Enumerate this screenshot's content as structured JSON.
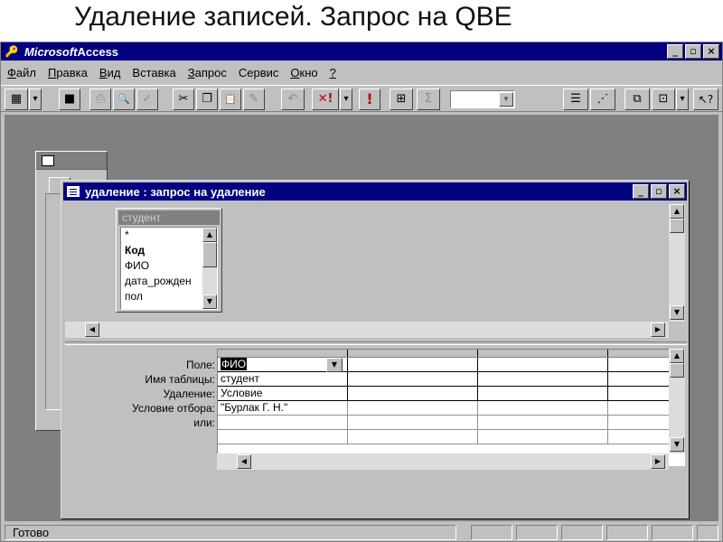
{
  "slide": {
    "title": "Удаление записей. Запрос на QBE"
  },
  "app": {
    "title_brand": "Microsoft",
    "title_rest": " Access",
    "window_buttons": [
      "_",
      "▫",
      "×"
    ]
  },
  "menu": {
    "items": [
      {
        "first": "Ф",
        "rest": "айл"
      },
      {
        "first": "П",
        "rest": "равка"
      },
      {
        "first": "В",
        "rest": "ид"
      },
      {
        "first": "",
        "rest": "Вставка"
      },
      {
        "first": "З",
        "rest": "апрос"
      },
      {
        "first": "",
        "rest": "Сервис"
      },
      {
        "first": "О",
        "rest": "кно"
      },
      {
        "first": "?",
        "rest": ""
      }
    ]
  },
  "toolbar": {
    "buttons": [
      {
        "name": "view-icon",
        "glyph": "▦"
      },
      {
        "name": "view-dropdown-icon",
        "glyph": "▾"
      },
      {
        "name": "save-icon",
        "glyph": "■"
      },
      {
        "name": "print-icon",
        "glyph": "⎙"
      },
      {
        "name": "print-preview-icon",
        "glyph": "🔍"
      },
      {
        "name": "spelling-icon",
        "glyph": "✓"
      },
      {
        "name": "cut-icon",
        "glyph": "✂"
      },
      {
        "name": "copy-icon",
        "glyph": "❐"
      },
      {
        "name": "paste-icon",
        "glyph": "📋"
      },
      {
        "name": "format-painter-icon",
        "glyph": "✎"
      },
      {
        "name": "undo-icon",
        "glyph": "↶"
      },
      {
        "name": "query-type-icon",
        "glyph": "✕!"
      },
      {
        "name": "query-type-dropdown-icon",
        "glyph": "▾"
      },
      {
        "name": "run-icon",
        "glyph": "!"
      },
      {
        "name": "show-table-icon",
        "glyph": "⊞"
      },
      {
        "name": "totals-icon",
        "glyph": "Σ"
      },
      {
        "name": "properties-icon",
        "glyph": "☰"
      },
      {
        "name": "build-icon",
        "glyph": "⋰"
      },
      {
        "name": "database-window-icon",
        "glyph": "⧉"
      },
      {
        "name": "new-object-icon",
        "glyph": "⊡"
      },
      {
        "name": "new-object-dropdown-icon",
        "glyph": "▾"
      },
      {
        "name": "help-icon",
        "glyph": "↖?"
      }
    ]
  },
  "query_window": {
    "title": "удаление : запрос на удаление",
    "table": {
      "name": "студент",
      "fields": [
        "*",
        "Код",
        "ФИО",
        "дата_рожден",
        "пол"
      ]
    },
    "row_labels": [
      "Поле:",
      "Имя таблицы:",
      "Удаление:",
      "Условие отбора:",
      "или:"
    ],
    "grid": {
      "column_1": [
        "ФИО",
        "студент",
        "Условие",
        "\"Бурлак Г. Н.\"",
        ""
      ]
    }
  },
  "statusbar": {
    "text": "Готово"
  },
  "icons": {
    "up": "▲",
    "down": "▼",
    "left": "◀",
    "right": "▶",
    "combo": "▼",
    "access_key": "🔑"
  }
}
